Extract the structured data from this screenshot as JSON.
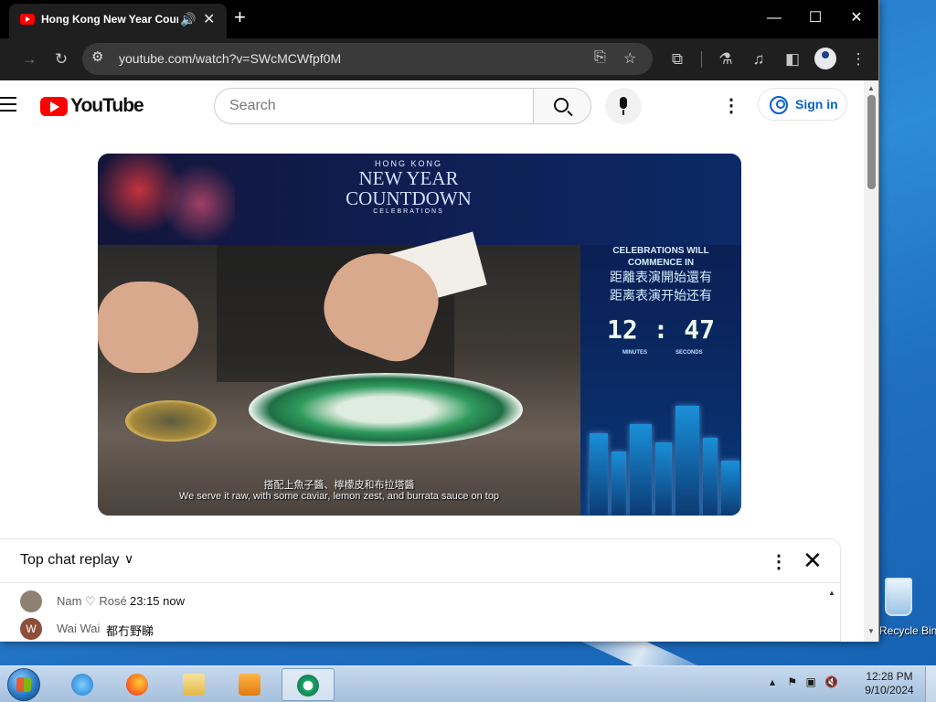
{
  "browser": {
    "tab_title": "Hong Kong New Year Countdown",
    "url": "youtube.com/watch?v=SWcMCWfpf0M"
  },
  "youtube": {
    "logo_text": "YouTube",
    "search_placeholder": "Search",
    "sign_in_label": "Sign in"
  },
  "video": {
    "logo_small": "HONG KONG",
    "logo_line1": "NEW YEAR",
    "logo_line2": "COUNTDOWN",
    "logo_sub": "CELEBRATIONS",
    "side_title_line1": "CELEBRATIONS WILL",
    "side_title_line2": "COMMENCE IN",
    "side_zh_traditional": "距離表演開始還有",
    "side_zh_simplified": "距离表演开始还有",
    "countdown": "12 : 47",
    "minutes_label": "MINUTES",
    "seconds_label": "SECONDS",
    "subtitle_zh": "搭配上魚子醬、檸檬皮和布拉塔醬",
    "subtitle_en": "We serve it raw, with some caviar, lemon zest, and burrata sauce on top"
  },
  "chat": {
    "title": "Top chat replay",
    "messages": [
      {
        "author": "Nam ♡ Rosé",
        "text": "23:15 now",
        "avatar_letter": "",
        "avatar_color": "#8d8271"
      },
      {
        "author": "Wai Wai",
        "text": "都冇野睇",
        "avatar_letter": "W",
        "avatar_color": "#8d4e3a"
      }
    ]
  },
  "desktop": {
    "recycle_bin_label": "Recycle Bin"
  },
  "taskbar": {
    "clock_time": "12:28 PM",
    "clock_date": "9/10/2024"
  }
}
